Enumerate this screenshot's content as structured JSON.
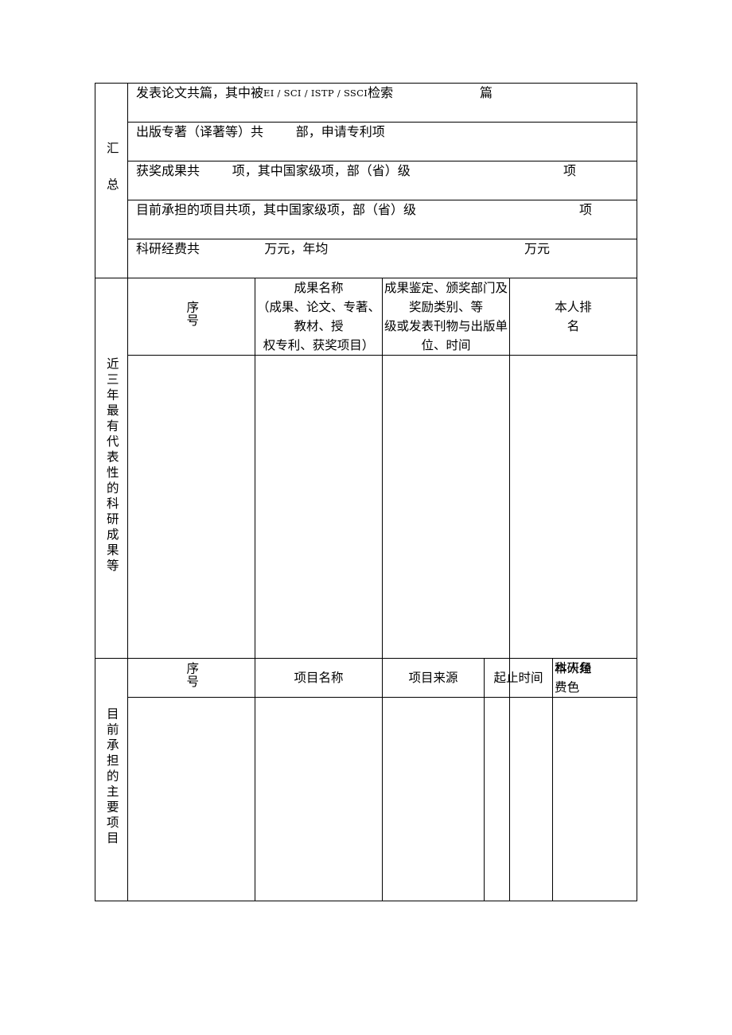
{
  "document": {
    "sections": {
      "summary": {
        "label_chars": "汇总",
        "label_parts": [
          "汇",
          "总"
        ],
        "rows": [
          {
            "id": "papers",
            "text_before": "发表论文共篇，其中被",
            "indexes": "EI / SCI / ISTP / SSCI",
            "text_after": "检索",
            "unit": "篇"
          },
          {
            "id": "monographs",
            "text": "出版专著（译著等）共        部，申请专利项",
            "unit": ""
          },
          {
            "id": "awards",
            "text": "获奖成果共        项，其中国家级项，部（省）级",
            "unit": "项"
          },
          {
            "id": "current-projects",
            "text": "目前承担的项目共项，其中国家级项，部（省）级",
            "unit": "项"
          },
          {
            "id": "funding",
            "text": "科研经费共                万元，年均",
            "unit": "万元"
          }
        ]
      },
      "achievements": {
        "label_chars": "近三年最有代表性的科研成果等",
        "headers": {
          "seq": "序号",
          "name_line1": "成果名称",
          "name_line2": "（成果、论文、专著、教材、授",
          "name_line3": "权专利、获奖项目）",
          "source_line1": "成果鉴定、颁奖部门及奖励类别、等",
          "source_line2": "级或发表刊物与出版单位、时间",
          "rank_line1": "本人排",
          "rank_line2": "名"
        },
        "rows": [
          {
            "seq": "",
            "name": "",
            "source": "",
            "rank": ""
          }
        ]
      },
      "projects": {
        "label_chars": "目前承担的主要项目",
        "headers": {
          "seq": "序号",
          "name": "项目名称",
          "source": "项目来源",
          "period": "起止时间",
          "funding_line1": "科研经",
          "funding_line2": "费",
          "role_line1": "本人角",
          "role_line2": "色"
        },
        "rows": [
          {
            "seq": "",
            "name": "",
            "source": "",
            "period": "",
            "funding": "",
            "role": ""
          }
        ]
      }
    }
  }
}
